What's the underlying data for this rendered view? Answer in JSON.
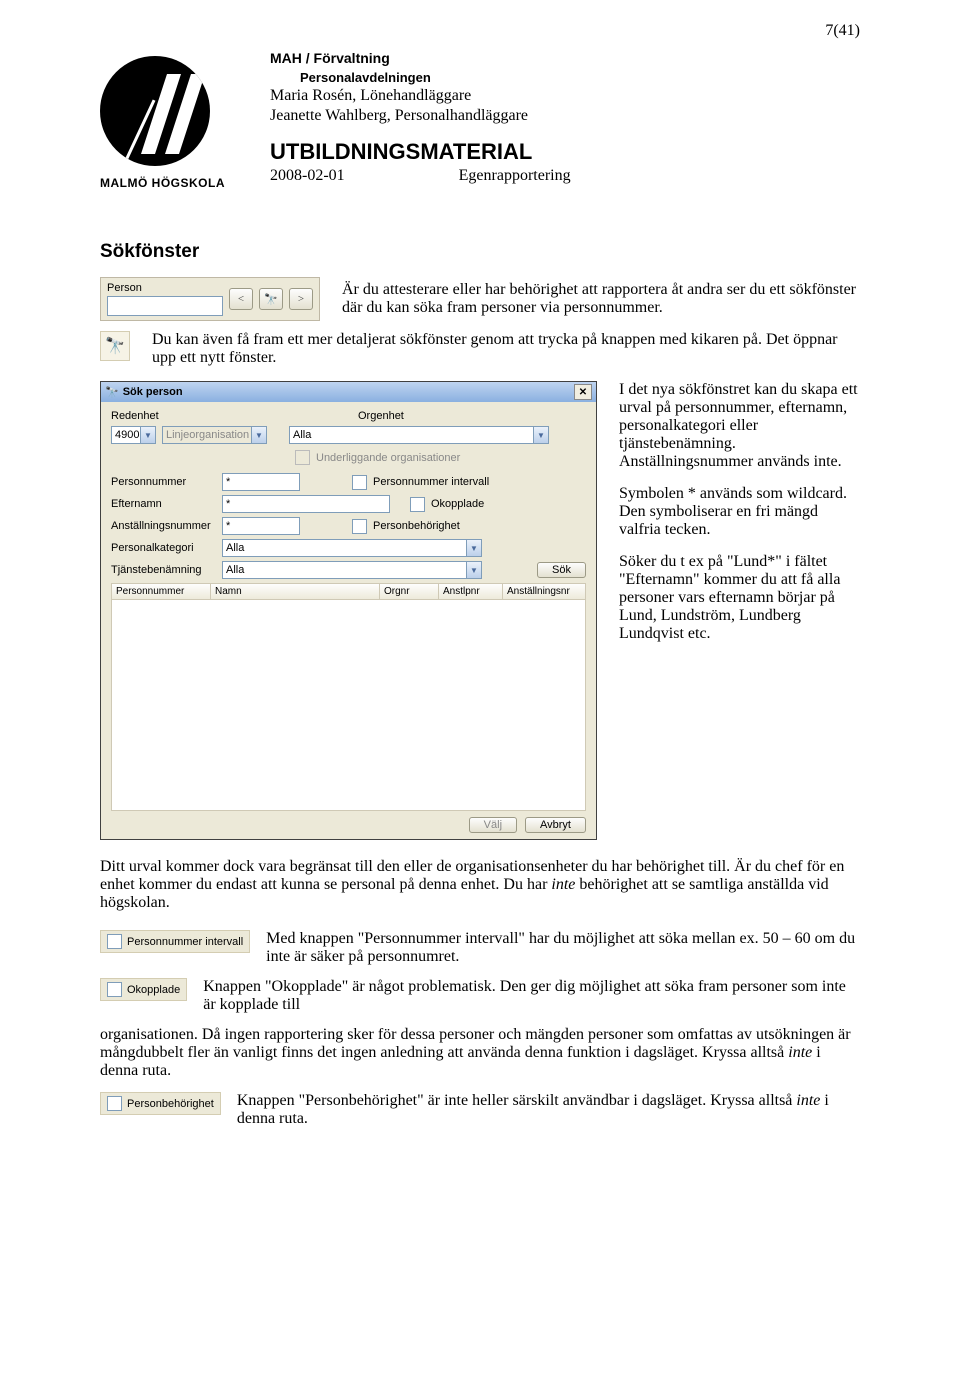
{
  "page_num": "7(41)",
  "header": {
    "org": "MAH / Förvaltning",
    "dept": "Personalavdelningen",
    "author1": "Maria Rosén, Lönehandläggare",
    "author2": "Jeanette Wahlberg, Personalhandläggare",
    "material": "UTBILDNINGSMATERIAL",
    "date": "2008-02-01",
    "subject": "Egenrapportering",
    "logo_text": "MALMÖ HÖGSKOLA"
  },
  "section_heading": "Sökfönster",
  "person_widget": {
    "label": "Person",
    "nav_prev": "<",
    "nav_next": ">",
    "binoc_icon": "🔍"
  },
  "intro_text": "Är du attesterare eller har behörighet att rapportera åt andra ser du ett sökfönster där du kan söka fram personer via personnummer.",
  "binoc_text": "Du kan även få fram ett mer detaljerat sökfönster genom att trycka på knappen med kikaren på. Det öppnar upp ett nytt fönster.",
  "dialog": {
    "title": "Sök person",
    "redenhet_lbl": "Redenhet",
    "redenhet_val": "4900",
    "linjeorg_val": "Linjeorganisation",
    "orgenhet_lbl": "Orgenhet",
    "orgenhet_val": "Alla",
    "under_chk_lbl": "Underliggande organisationer",
    "pnr_lbl": "Personnummer",
    "pnr_val": "*",
    "pnr_int_lbl": "Personnummer intervall",
    "eft_lbl": "Efternamn",
    "eft_val": "*",
    "okopp_lbl": "Okopplade",
    "anst_lbl": "Anställningsnummer",
    "anst_val": "*",
    "pbeh_lbl": "Personbehörighet",
    "pkat_lbl": "Personalkategori",
    "pkat_val": "Alla",
    "tjb_lbl": "Tjänstebenämning",
    "tjb_val": "Alla",
    "sok_btn": "Sök",
    "col1": "Personnummer",
    "col2": "Namn",
    "col3": "Orgnr",
    "col4": "Anstlpnr",
    "col5": "Anställningsnr",
    "valj_btn": "Välj",
    "avbryt_btn": "Avbryt"
  },
  "side_p1": "I det nya sökfönstret kan du skapa ett urval på personnummer, efternamn, personalkategori eller tjänstebenämning. Anställningsnummer används inte.",
  "side_p2": "Symbolen * används som wildcard. Den symboliserar en fri mängd valfria tecken.",
  "side_p3": "Söker du t ex på \"Lund*\" i fältet \"Efternamn\" kommer du att få alla personer vars efternamn börjar på Lund, Lundström, Lundberg Lundqvist etc.",
  "body_p1a": "Ditt urval kommer dock vara begränsat till den eller de organisationsenheter du har behörighet till. Är du chef för en enhet kommer du endast att kunna se personal på denna enhet. Du har ",
  "body_p1_ital": "inte",
  "body_p1b": " behörighet att se samtliga anställda vid högskolan.",
  "icon_pnr_lbl": "Personnummer intervall",
  "icon_pnr_text": "Med knappen \"Personnummer intervall\" har du möjlighet att söka mellan ex. 50 – 60 om du inte är säker på personnumret.",
  "icon_okopp_lbl": "Okopplade",
  "icon_okopp_text": "Knappen \"Okopplade\" är något problematisk. Den ger dig möjlighet att söka fram personer som inte är kopplade till ",
  "body_p2a": "organisationen. Då ingen rapportering sker för dessa personer och mängden personer som omfattas av utsökningen är mångdubbelt fler än vanligt finns det ingen anledning att använda denna funktion i dagsläget. Kryssa alltså ",
  "body_p2_ital": "inte",
  "body_p2b": " i denna ruta.",
  "icon_pbeh_lbl": "Personbehörighet",
  "icon_pbeh_text_a": "Knappen \"Personbehörighet\" är inte heller särskilt användbar i dagsläget. Kryssa alltså ",
  "icon_pbeh_ital": "inte",
  "icon_pbeh_text_b": " i denna ruta."
}
